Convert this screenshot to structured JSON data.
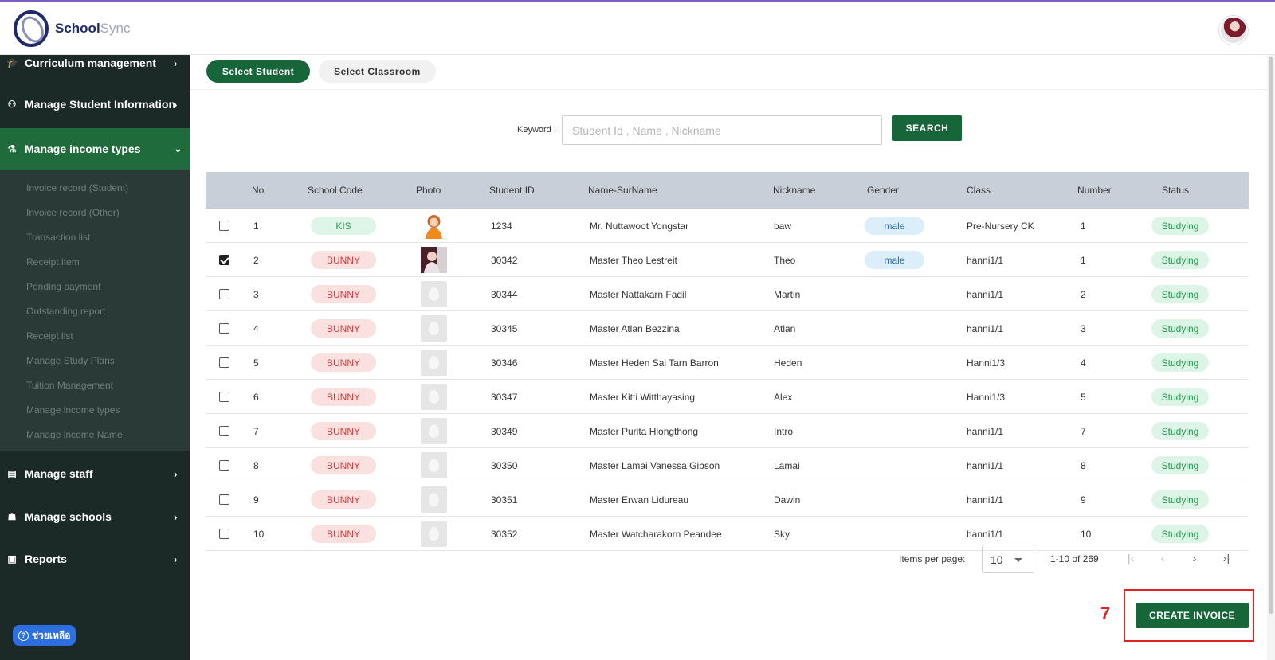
{
  "header": {
    "brand_part1": "School",
    "brand_part2": "Sync"
  },
  "sidebar": {
    "items": [
      {
        "label": "Curriculum management",
        "icon": "graduation-cap-icon",
        "chevron": "›"
      },
      {
        "label": "Manage Student Information",
        "icon": "student-icon",
        "chevron": "›"
      },
      {
        "label": "Manage income types",
        "icon": "income-icon",
        "chevron": "⌄"
      },
      {
        "label": "Manage staff",
        "icon": "staff-icon",
        "chevron": "›"
      },
      {
        "label": "Manage schools",
        "icon": "schools-icon",
        "chevron": "›"
      },
      {
        "label": "Reports",
        "icon": "clipboard-icon",
        "chevron": "›"
      }
    ],
    "sub_items": [
      "Invoice record (Student)",
      "Invoice record (Other)",
      "Transaction list",
      "Receipt item",
      "Pending payment",
      "Outstanding report",
      "Receipt list",
      "Manage Study Plans",
      "Tuition Management",
      "Manage income types",
      "Manage income Name"
    ],
    "help_label": "ช่วยเหลือ"
  },
  "tabs": {
    "student": "Select Student",
    "classroom": "Select Classroom"
  },
  "search": {
    "label": "Keyword :",
    "placeholder": "Student Id , Name , Nickname",
    "button": "SEARCH"
  },
  "table": {
    "headers": [
      "No",
      "School Code",
      "Photo",
      "Student ID",
      "Name-SurName",
      "Nickname",
      "Gender",
      "Class",
      "Number",
      "Status"
    ],
    "rows": [
      {
        "no": "1",
        "school": "KIS",
        "photo": "cartoon",
        "id": "1234",
        "name": "Mr. Nuttawoot Yongstar",
        "nick": "baw",
        "gender": "male",
        "class": "Pre-Nursery CK",
        "number": "1",
        "status": "Studying",
        "checked": false
      },
      {
        "no": "2",
        "school": "BUNNY",
        "photo": "portrait",
        "id": "30342",
        "name": "Master Theo Lestreit",
        "nick": "Theo",
        "gender": "male",
        "class": "hanni1/1",
        "number": "1",
        "status": "Studying",
        "checked": true
      },
      {
        "no": "3",
        "school": "BUNNY",
        "photo": "placeholder",
        "id": "30344",
        "name": "Master Nattakarn Fadil",
        "nick": "Martin",
        "gender": "",
        "class": "hanni1/1",
        "number": "2",
        "status": "Studying",
        "checked": false
      },
      {
        "no": "4",
        "school": "BUNNY",
        "photo": "placeholder",
        "id": "30345",
        "name": "Master Atlan Bezzina",
        "nick": "Atlan",
        "gender": "",
        "class": "hanni1/1",
        "number": "3",
        "status": "Studying",
        "checked": false
      },
      {
        "no": "5",
        "school": "BUNNY",
        "photo": "placeholder",
        "id": "30346",
        "name": "Master Heden Sai Tarn Barron",
        "nick": "Heden",
        "gender": "",
        "class": "Hanni1/3",
        "number": "4",
        "status": "Studying",
        "checked": false
      },
      {
        "no": "6",
        "school": "BUNNY",
        "photo": "placeholder",
        "id": "30347",
        "name": "Master Kitti Witthayasing",
        "nick": "Alex",
        "gender": "",
        "class": "Hanni1/3",
        "number": "5",
        "status": "Studying",
        "checked": false
      },
      {
        "no": "7",
        "school": "BUNNY",
        "photo": "placeholder",
        "id": "30349",
        "name": "Master Purita Hlongthong",
        "nick": "Intro",
        "gender": "",
        "class": "hanni1/1",
        "number": "7",
        "status": "Studying",
        "checked": false
      },
      {
        "no": "8",
        "school": "BUNNY",
        "photo": "placeholder",
        "id": "30350",
        "name": "Master Lamai Vanessa Gibson",
        "nick": "Lamai",
        "gender": "",
        "class": "hanni1/1",
        "number": "8",
        "status": "Studying",
        "checked": false
      },
      {
        "no": "9",
        "school": "BUNNY",
        "photo": "placeholder",
        "id": "30351",
        "name": "Master Erwan Lidureau",
        "nick": "Dawin",
        "gender": "",
        "class": "hanni1/1",
        "number": "9",
        "status": "Studying",
        "checked": false
      },
      {
        "no": "10",
        "school": "BUNNY",
        "photo": "placeholder",
        "id": "30352",
        "name": "Master Watcharakorn Peandee",
        "nick": "Sky",
        "gender": "",
        "class": "hanni1/1",
        "number": "10",
        "status": "Studying",
        "checked": false
      }
    ]
  },
  "pagination": {
    "items_label": "Items per page:",
    "page_size": "10",
    "range": "1-10 of 269"
  },
  "actions": {
    "step_marker": "7",
    "create_invoice": "CREATE INVOICE"
  },
  "colors": {
    "primary_green": "#17663a",
    "sidebar_bg": "#1b2a27",
    "annotation_red": "#e02424"
  }
}
